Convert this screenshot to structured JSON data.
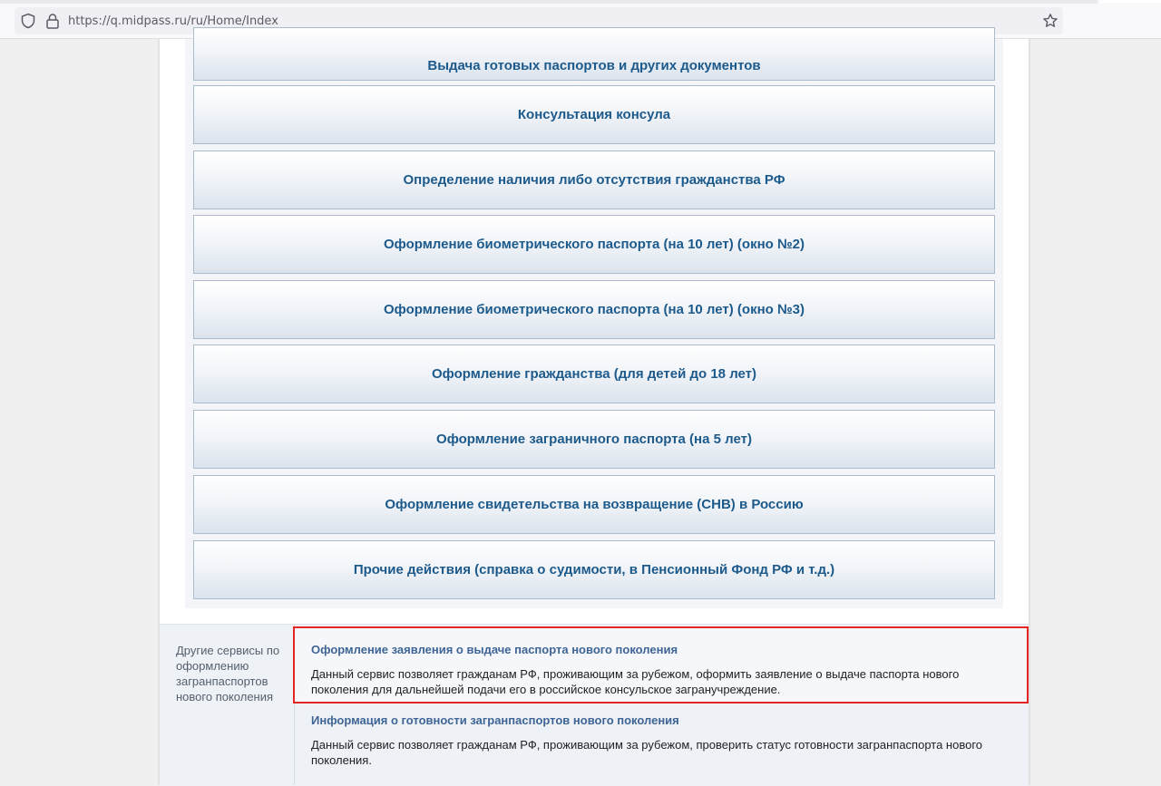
{
  "browser": {
    "url": "https://q.midpass.ru/ru/Home/Index"
  },
  "services": [
    {
      "label": "Выдача готовых паспортов и других документов"
    },
    {
      "label": "Консультация консула"
    },
    {
      "label": "Определение наличия либо отсутствия гражданства РФ"
    },
    {
      "label": "Оформление биометрического паспорта (на 10 лет) (окно №2)"
    },
    {
      "label": "Оформление биометрического паспорта (на 10 лет) (окно №3)"
    },
    {
      "label": "Оформление гражданства (для детей до 18 лет)"
    },
    {
      "label": "Оформление заграничного паспорта (на 5 лет)"
    },
    {
      "label": "Оформление свидетельства на возвращение (СНВ) в Россию"
    },
    {
      "label": "Прочие действия (справка о судимости, в Пенсионный Фонд РФ и т.д.)"
    }
  ],
  "footer": {
    "label": "Другие сервисы по оформлению загранпаспортов нового поколения",
    "items": [
      {
        "title": "Оформление заявления о выдаче паспорта нового поколения",
        "description": "Данный сервис позволяет гражданам РФ, проживающим за рубежом, оформить заявление о выдаче паспорта нового поколения для дальнейшей подачи его в российское консульское загранучреждение."
      },
      {
        "title": "Информация о готовности загранпаспортов нового поколения",
        "description": "Данный сервис позволяет гражданам РФ, проживающим за рубежом, проверить статус готовности загранпаспорта нового поколения."
      }
    ]
  },
  "colors": {
    "highlight": "#e32624",
    "button_text": "#1d5a8c",
    "link": "#3e6595"
  }
}
